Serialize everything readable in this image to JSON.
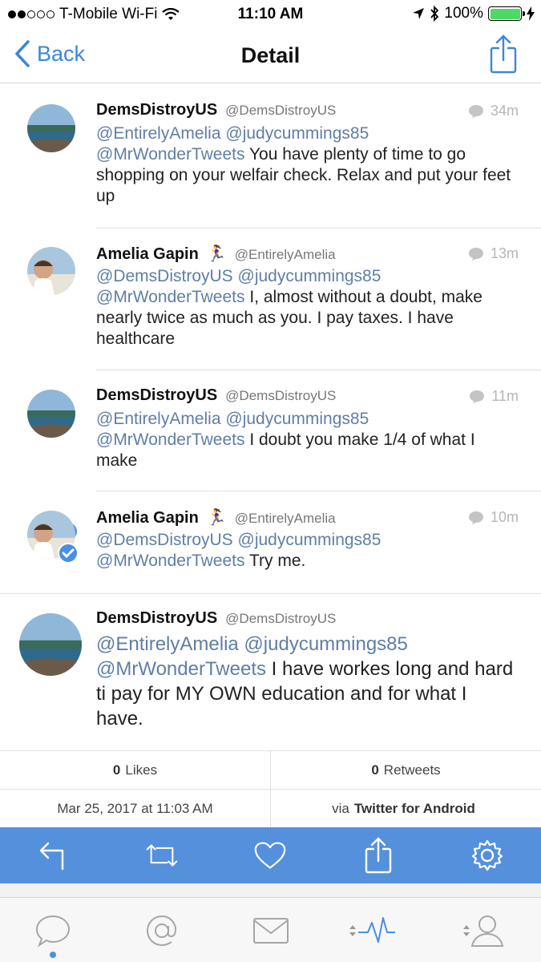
{
  "status_bar": {
    "carrier": "T-Mobile Wi-Fi",
    "time": "11:10 AM",
    "battery": "100%"
  },
  "nav": {
    "back_label": "Back",
    "title": "Detail"
  },
  "tweets": [
    {
      "name": "DemsDistroyUS",
      "handle": "@DemsDistroyUS",
      "time": "34m",
      "mentions": [
        "@EntirelyAmelia",
        "@judycummings85",
        "@MrWonderTweets"
      ],
      "text": "You have plenty of time to go shopping on your welfair check. Relax and put your feet up"
    },
    {
      "name": "Amelia Gapin",
      "emoji": "🏃‍♀️",
      "handle": "@EntirelyAmelia",
      "time": "13m",
      "mentions": [
        "@DemsDistroyUS",
        "@judycummings85",
        "@MrWonderTweets"
      ],
      "text": "I, almost without a doubt, make nearly twice as much as you. I pay taxes. I have healthcare"
    },
    {
      "name": "DemsDistroyUS",
      "handle": "@DemsDistroyUS",
      "time": "11m",
      "mentions": [
        "@EntirelyAmelia",
        "@judycummings85",
        "@MrWonderTweets"
      ],
      "text": "I doubt you make 1/4 of what I make"
    },
    {
      "name": "Amelia Gapin",
      "emoji": "🏃‍♀️",
      "handle": "@EntirelyAmelia",
      "time": "10m",
      "mentions": [
        "@DemsDistroyUS",
        "@judycummings85",
        "@MrWonderTweets"
      ],
      "text": "Try me."
    }
  ],
  "main_tweet": {
    "name": "DemsDistroyUS",
    "handle": "@DemsDistroyUS",
    "mentions": [
      "@EntirelyAmelia",
      "@judycummings85",
      "@MrWonderTweets"
    ],
    "text": "I have workes long and hard ti pay for MY OWN education and for what I have."
  },
  "stats": {
    "likes_count": "0",
    "likes_label": "Likes",
    "retweets_count": "0",
    "retweets_label": "Retweets",
    "date": "Mar 25, 2017 at 11:03 AM",
    "via_prefix": "via",
    "via_app": "Twitter for Android"
  },
  "action_bar": {
    "icons": [
      "reply-icon",
      "retweet-icon",
      "heart-icon",
      "share-icon",
      "gear-icon"
    ]
  },
  "tabbar": {
    "icons": [
      "chat-bubble-icon",
      "at-sign-icon",
      "envelope-icon",
      "activity-icon",
      "profile-icon"
    ]
  },
  "colors": {
    "accent": "#3d86d8",
    "action_bar": "#5590dc",
    "mention": "#5f7ea6",
    "battery": "#4cd964"
  }
}
